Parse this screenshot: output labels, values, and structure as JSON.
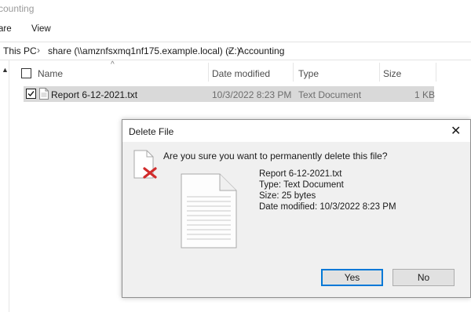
{
  "window": {
    "title": "counting"
  },
  "ribbon": {
    "tabs": [
      "are",
      "View"
    ]
  },
  "address": {
    "crumbs": [
      "This PC",
      "share (\\\\amznfsxmq1nf175.example.local) (Z:)",
      "Accounting"
    ]
  },
  "columns": {
    "name": "Name",
    "date": "Date modified",
    "type": "Type",
    "size": "Size"
  },
  "file": {
    "name": "Report 6-12-2021.txt",
    "date": "10/3/2022 8:23 PM",
    "type": "Text Document",
    "size": "1 KB",
    "checked": true
  },
  "dialog": {
    "title": "Delete File",
    "message": "Are you sure you want to permanently delete this file?",
    "file_name": "Report 6-12-2021.txt",
    "file_type": "Type: Text Document",
    "file_size": "Size: 25 bytes",
    "file_date": "Date modified: 10/3/2022 8:23 PM",
    "yes_label": "Yes",
    "no_label": "No",
    "icons": {
      "delete": "delete-file-icon",
      "document": "text-document-icon",
      "close": "close-icon"
    },
    "accent_color": "#0078d7",
    "delete_mark_color": "#d12c2c"
  }
}
